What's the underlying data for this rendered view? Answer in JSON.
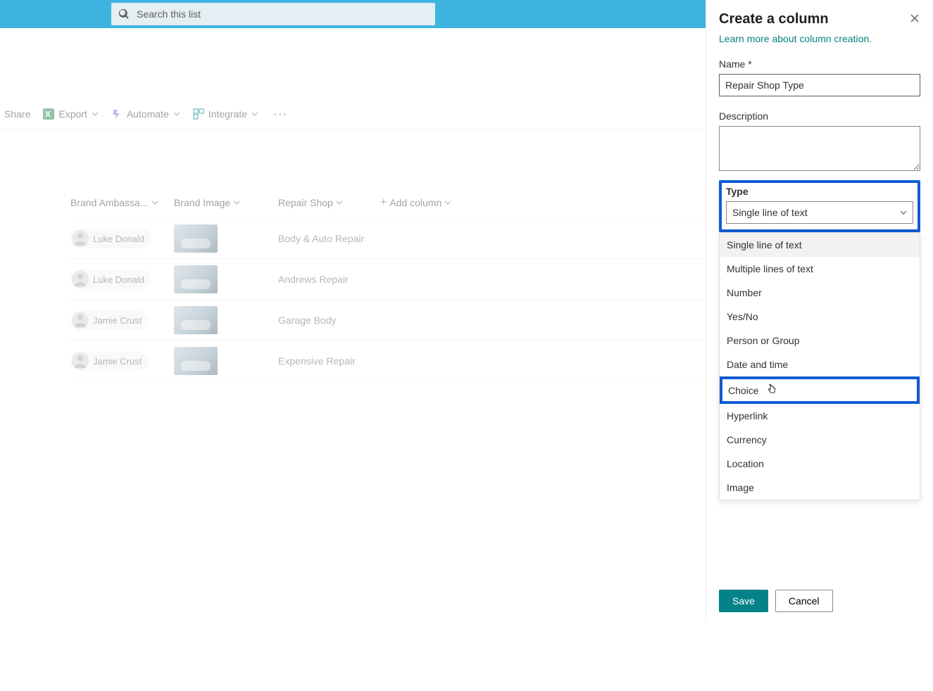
{
  "search": {
    "placeholder": "Search this list"
  },
  "commandbar": {
    "share": "Share",
    "export": "Export",
    "automate": "Automate",
    "integrate": "Integrate"
  },
  "columns": {
    "brand_ambassador": "Brand Ambassa...",
    "brand_image": "Brand Image",
    "repair_shop": "Repair Shop",
    "add_column": "Add column"
  },
  "rows": [
    {
      "ambassador": "Luke Donald",
      "repair_shop": "Body & Auto Repair"
    },
    {
      "ambassador": "Luke Donald",
      "repair_shop": "Andrews Repair"
    },
    {
      "ambassador": "Jamie Crust",
      "repair_shop": "Garage Body"
    },
    {
      "ambassador": "Jamie Crust",
      "repair_shop": "Expensive Repair"
    }
  ],
  "panel": {
    "title": "Create a column",
    "learn_more": "Learn more about column creation.",
    "name_label": "Name *",
    "name_value": "Repair Shop Type",
    "description_label": "Description",
    "description_value": "",
    "type_label": "Type",
    "type_selected": "Single line of text",
    "type_options": [
      "Single line of text",
      "Multiple lines of text",
      "Number",
      "Yes/No",
      "Person or Group",
      "Date and time",
      "Choice",
      "Hyperlink",
      "Currency",
      "Location",
      "Image"
    ],
    "highlighted_option": "Choice",
    "save": "Save",
    "cancel": "Cancel"
  }
}
